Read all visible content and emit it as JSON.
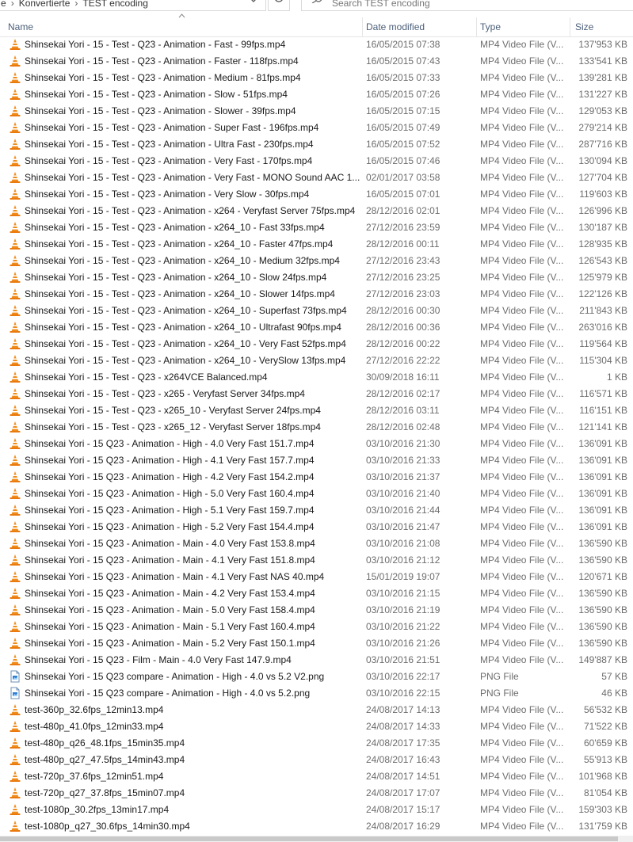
{
  "address": {
    "crumb_1": "e",
    "crumb_2": "Konvertierte",
    "crumb_3": "TEST encoding"
  },
  "search": {
    "placeholder": "Search TEST encoding"
  },
  "columns": {
    "name": "Name",
    "date": "Date modified",
    "type": "Type",
    "size": "Size"
  },
  "icons": {
    "mp4": "vlc-cone-icon",
    "png": "png-file-icon"
  },
  "colors": {
    "vlc_orange": "#f08c1a",
    "header_text": "#4c607a"
  },
  "files": [
    {
      "name": "Shinsekai Yori - 15 - Test - Q23 - Animation - Fast - 99fps.mp4",
      "date": "16/05/2015 07:38",
      "type": "MP4 Video File (V...",
      "size": "137'953 KB",
      "kind": "mp4"
    },
    {
      "name": "Shinsekai Yori - 15 - Test - Q23 - Animation - Faster - 118fps.mp4",
      "date": "16/05/2015 07:43",
      "type": "MP4 Video File (V...",
      "size": "133'541 KB",
      "kind": "mp4"
    },
    {
      "name": "Shinsekai Yori - 15 - Test - Q23 - Animation - Medium - 81fps.mp4",
      "date": "16/05/2015 07:33",
      "type": "MP4 Video File (V...",
      "size": "139'281 KB",
      "kind": "mp4"
    },
    {
      "name": "Shinsekai Yori - 15 - Test - Q23 - Animation - Slow - 51fps.mp4",
      "date": "16/05/2015 07:26",
      "type": "MP4 Video File (V...",
      "size": "131'227 KB",
      "kind": "mp4"
    },
    {
      "name": "Shinsekai Yori - 15 - Test - Q23 - Animation - Slower - 39fps.mp4",
      "date": "16/05/2015 07:15",
      "type": "MP4 Video File (V...",
      "size": "129'053 KB",
      "kind": "mp4"
    },
    {
      "name": "Shinsekai Yori - 15 - Test - Q23 - Animation - Super Fast - 196fps.mp4",
      "date": "16/05/2015 07:49",
      "type": "MP4 Video File (V...",
      "size": "279'214 KB",
      "kind": "mp4"
    },
    {
      "name": "Shinsekai Yori - 15 - Test - Q23 - Animation - Ultra Fast - 230fps.mp4",
      "date": "16/05/2015 07:52",
      "type": "MP4 Video File (V...",
      "size": "287'716 KB",
      "kind": "mp4"
    },
    {
      "name": "Shinsekai Yori - 15 - Test - Q23 - Animation - Very Fast - 170fps.mp4",
      "date": "16/05/2015 07:46",
      "type": "MP4 Video File (V...",
      "size": "130'094 KB",
      "kind": "mp4"
    },
    {
      "name": "Shinsekai Yori - 15 - Test - Q23 - Animation - Very Fast - MONO Sound AAC 1...",
      "date": "02/01/2017 03:58",
      "type": "MP4 Video File (V...",
      "size": "127'704 KB",
      "kind": "mp4"
    },
    {
      "name": "Shinsekai Yori - 15 - Test - Q23 - Animation - Very Slow - 30fps.mp4",
      "date": "16/05/2015 07:01",
      "type": "MP4 Video File (V...",
      "size": "119'603 KB",
      "kind": "mp4"
    },
    {
      "name": "Shinsekai Yori - 15 - Test - Q23 - Animation - x264 - Veryfast Server 75fps.mp4",
      "date": "28/12/2016 02:01",
      "type": "MP4 Video File (V...",
      "size": "126'996 KB",
      "kind": "mp4"
    },
    {
      "name": "Shinsekai Yori - 15 - Test - Q23 - Animation - x264_10 - Fast 33fps.mp4",
      "date": "27/12/2016 23:59",
      "type": "MP4 Video File (V...",
      "size": "130'187 KB",
      "kind": "mp4"
    },
    {
      "name": "Shinsekai Yori - 15 - Test - Q23 - Animation - x264_10 - Faster 47fps.mp4",
      "date": "28/12/2016 00:11",
      "type": "MP4 Video File (V...",
      "size": "128'935 KB",
      "kind": "mp4"
    },
    {
      "name": "Shinsekai Yori - 15 - Test - Q23 - Animation - x264_10 - Medium 32fps.mp4",
      "date": "27/12/2016 23:43",
      "type": "MP4 Video File (V...",
      "size": "126'543 KB",
      "kind": "mp4"
    },
    {
      "name": "Shinsekai Yori - 15 - Test - Q23 - Animation - x264_10 - Slow 24fps.mp4",
      "date": "27/12/2016 23:25",
      "type": "MP4 Video File (V...",
      "size": "125'979 KB",
      "kind": "mp4"
    },
    {
      "name": "Shinsekai Yori - 15 - Test - Q23 - Animation - x264_10 - Slower 14fps.mp4",
      "date": "27/12/2016 23:03",
      "type": "MP4 Video File (V...",
      "size": "122'126 KB",
      "kind": "mp4"
    },
    {
      "name": "Shinsekai Yori - 15 - Test - Q23 - Animation - x264_10 - Superfast 73fps.mp4",
      "date": "28/12/2016 00:30",
      "type": "MP4 Video File (V...",
      "size": "211'843 KB",
      "kind": "mp4"
    },
    {
      "name": "Shinsekai Yori - 15 - Test - Q23 - Animation - x264_10 - Ultrafast 90fps.mp4",
      "date": "28/12/2016 00:36",
      "type": "MP4 Video File (V...",
      "size": "263'016 KB",
      "kind": "mp4"
    },
    {
      "name": "Shinsekai Yori - 15 - Test - Q23 - Animation - x264_10 - Very Fast 52fps.mp4",
      "date": "28/12/2016 00:22",
      "type": "MP4 Video File (V...",
      "size": "119'564 KB",
      "kind": "mp4"
    },
    {
      "name": "Shinsekai Yori - 15 - Test - Q23 - Animation - x264_10 - VerySlow 13fps.mp4",
      "date": "27/12/2016 22:22",
      "type": "MP4 Video File (V...",
      "size": "115'304 KB",
      "kind": "mp4"
    },
    {
      "name": "Shinsekai Yori - 15 - Test - Q23 - x264VCE Balanced.mp4",
      "date": "30/09/2018 16:11",
      "type": "MP4 Video File (V...",
      "size": "1 KB",
      "kind": "mp4"
    },
    {
      "name": "Shinsekai Yori - 15 - Test - Q23 - x265 - Veryfast Server 34fps.mp4",
      "date": "28/12/2016 02:17",
      "type": "MP4 Video File (V...",
      "size": "116'571 KB",
      "kind": "mp4"
    },
    {
      "name": "Shinsekai Yori - 15 - Test - Q23 - x265_10 - Veryfast Server 24fps.mp4",
      "date": "28/12/2016 03:11",
      "type": "MP4 Video File (V...",
      "size": "116'151 KB",
      "kind": "mp4"
    },
    {
      "name": "Shinsekai Yori - 15 - Test - Q23 - x265_12 - Veryfast Server 18fps.mp4",
      "date": "28/12/2016 02:48",
      "type": "MP4 Video File (V...",
      "size": "121'141 KB",
      "kind": "mp4"
    },
    {
      "name": "Shinsekai Yori - 15 Q23 - Animation - High - 4.0 Very Fast 151.7.mp4",
      "date": "03/10/2016 21:30",
      "type": "MP4 Video File (V...",
      "size": "136'091 KB",
      "kind": "mp4"
    },
    {
      "name": "Shinsekai Yori - 15 Q23 - Animation - High - 4.1 Very Fast 157.7.mp4",
      "date": "03/10/2016 21:33",
      "type": "MP4 Video File (V...",
      "size": "136'091 KB",
      "kind": "mp4"
    },
    {
      "name": "Shinsekai Yori - 15 Q23 - Animation - High - 4.2 Very Fast 154.2.mp4",
      "date": "03/10/2016 21:37",
      "type": "MP4 Video File (V...",
      "size": "136'091 KB",
      "kind": "mp4"
    },
    {
      "name": "Shinsekai Yori - 15 Q23 - Animation - High - 5.0 Very Fast 160.4.mp4",
      "date": "03/10/2016 21:40",
      "type": "MP4 Video File (V...",
      "size": "136'091 KB",
      "kind": "mp4"
    },
    {
      "name": "Shinsekai Yori - 15 Q23 - Animation - High - 5.1 Very Fast 159.7.mp4",
      "date": "03/10/2016 21:44",
      "type": "MP4 Video File (V...",
      "size": "136'091 KB",
      "kind": "mp4"
    },
    {
      "name": "Shinsekai Yori - 15 Q23 - Animation - High - 5.2 Very Fast 154.4.mp4",
      "date": "03/10/2016 21:47",
      "type": "MP4 Video File (V...",
      "size": "136'091 KB",
      "kind": "mp4"
    },
    {
      "name": "Shinsekai Yori - 15 Q23 - Animation - Main - 4.0 Very Fast 153.8.mp4",
      "date": "03/10/2016 21:08",
      "type": "MP4 Video File (V...",
      "size": "136'590 KB",
      "kind": "mp4"
    },
    {
      "name": "Shinsekai Yori - 15 Q23 - Animation - Main - 4.1 Very Fast 151.8.mp4",
      "date": "03/10/2016 21:12",
      "type": "MP4 Video File (V...",
      "size": "136'590 KB",
      "kind": "mp4"
    },
    {
      "name": "Shinsekai Yori - 15 Q23 - Animation - Main - 4.1 Very Fast NAS 40.mp4",
      "date": "15/01/2019 19:07",
      "type": "MP4 Video File (V...",
      "size": "120'671 KB",
      "kind": "mp4"
    },
    {
      "name": "Shinsekai Yori - 15 Q23 - Animation - Main - 4.2 Very Fast 153.4.mp4",
      "date": "03/10/2016 21:15",
      "type": "MP4 Video File (V...",
      "size": "136'590 KB",
      "kind": "mp4"
    },
    {
      "name": "Shinsekai Yori - 15 Q23 - Animation - Main - 5.0 Very Fast 158.4.mp4",
      "date": "03/10/2016 21:19",
      "type": "MP4 Video File (V...",
      "size": "136'590 KB",
      "kind": "mp4"
    },
    {
      "name": "Shinsekai Yori - 15 Q23 - Animation - Main - 5.1 Very Fast 160.4.mp4",
      "date": "03/10/2016 21:22",
      "type": "MP4 Video File (V...",
      "size": "136'590 KB",
      "kind": "mp4"
    },
    {
      "name": "Shinsekai Yori - 15 Q23 - Animation - Main - 5.2 Very Fast 150.1.mp4",
      "date": "03/10/2016 21:26",
      "type": "MP4 Video File (V...",
      "size": "136'590 KB",
      "kind": "mp4"
    },
    {
      "name": "Shinsekai Yori - 15 Q23 - Film - Main - 4.0 Very Fast 147.9.mp4",
      "date": "03/10/2016 21:51",
      "type": "MP4 Video File (V...",
      "size": "149'887 KB",
      "kind": "mp4"
    },
    {
      "name": "Shinsekai Yori - 15 Q23 compare - Animation - High - 4.0 vs 5.2 V2.png",
      "date": "03/10/2016 22:17",
      "type": "PNG File",
      "size": "57 KB",
      "kind": "png"
    },
    {
      "name": "Shinsekai Yori - 15 Q23 compare - Animation - High - 4.0 vs 5.2.png",
      "date": "03/10/2016 22:15",
      "type": "PNG File",
      "size": "46 KB",
      "kind": "png"
    },
    {
      "name": "test-360p_32.6fps_12min13.mp4",
      "date": "24/08/2017 14:13",
      "type": "MP4 Video File (V...",
      "size": "56'532 KB",
      "kind": "mp4"
    },
    {
      "name": "test-480p_41.0fps_12min33.mp4",
      "date": "24/08/2017 14:33",
      "type": "MP4 Video File (V...",
      "size": "71'522 KB",
      "kind": "mp4"
    },
    {
      "name": "test-480p_q26_48.1fps_15min35.mp4",
      "date": "24/08/2017 17:35",
      "type": "MP4 Video File (V...",
      "size": "60'659 KB",
      "kind": "mp4"
    },
    {
      "name": "test-480p_q27_47.5fps_14min43.mp4",
      "date": "24/08/2017 16:43",
      "type": "MP4 Video File (V...",
      "size": "55'913 KB",
      "kind": "mp4"
    },
    {
      "name": "test-720p_37.6fps_12min51.mp4",
      "date": "24/08/2017 14:51",
      "type": "MP4 Video File (V...",
      "size": "101'968 KB",
      "kind": "mp4"
    },
    {
      "name": "test-720p_q27_37.8fps_15min07.mp4",
      "date": "24/08/2017 17:07",
      "type": "MP4 Video File (V...",
      "size": "81'054 KB",
      "kind": "mp4"
    },
    {
      "name": "test-1080p_30.2fps_13min17.mp4",
      "date": "24/08/2017 15:17",
      "type": "MP4 Video File (V...",
      "size": "159'303 KB",
      "kind": "mp4"
    },
    {
      "name": "test-1080p_q27_30.6fps_14min30.mp4",
      "date": "24/08/2017 16:29",
      "type": "MP4 Video File (V...",
      "size": "131'759 KB",
      "kind": "mp4"
    }
  ]
}
